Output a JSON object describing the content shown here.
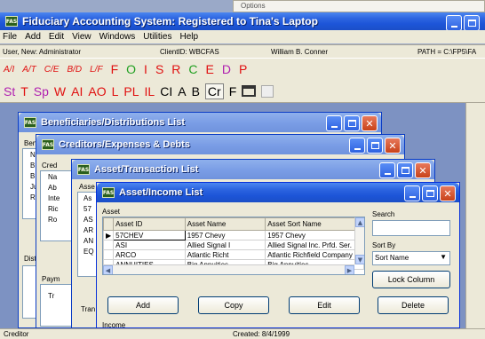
{
  "options_label": "Options",
  "app": {
    "title": "Fiduciary Accounting System: Registered to Tina's Laptop",
    "icon_text": "FAS"
  },
  "menu": [
    "File",
    "Add",
    "Edit",
    "View",
    "Windows",
    "Utilities",
    "Help"
  ],
  "status": {
    "user": "User, New: Administrator",
    "client": "ClientID: WBCFAS",
    "name": "William B. Conner",
    "path": "PATH = C:\\FP5\\FA"
  },
  "toolbar1": {
    "fraction_buttons": [
      "A/I",
      "A/T",
      "C/E",
      "B/D",
      "L/F"
    ],
    "letters": [
      {
        "text": "F",
        "color": "#e01010"
      },
      {
        "text": "O",
        "color": "#22a022"
      },
      {
        "text": "I",
        "color": "#e01010"
      },
      {
        "text": "S",
        "color": "#e01010"
      },
      {
        "text": "R",
        "color": "#e01010"
      },
      {
        "text": "C",
        "color": "#22a022"
      },
      {
        "text": "E",
        "color": "#e01010"
      },
      {
        "text": "D",
        "color": "#b020b0"
      },
      {
        "text": "P",
        "color": "#e01010"
      }
    ]
  },
  "toolbar2": [
    {
      "text": "St",
      "color": "#b020b0"
    },
    {
      "text": "T",
      "color": "#e01010"
    },
    {
      "text": "Sp",
      "color": "#b020b0"
    },
    {
      "text": "W",
      "color": "#e01010"
    },
    {
      "text": "AI",
      "color": "#e01010"
    },
    {
      "text": "AO",
      "color": "#e01010"
    },
    {
      "text": "L",
      "color": "#e01010"
    },
    {
      "text": "PL",
      "color": "#e01010"
    },
    {
      "text": "IL",
      "color": "#e01010"
    },
    {
      "text": "CI",
      "color": "#000000"
    },
    {
      "text": "A",
      "color": "#000000"
    },
    {
      "text": "B",
      "color": "#000000"
    },
    {
      "text": "Cr",
      "color": "#000000"
    },
    {
      "text": "F",
      "color": "#000000"
    }
  ],
  "windows": {
    "beneficiaries": {
      "title": "Beneficiaries/Distributions List",
      "frag_header": "Ben",
      "frag_rows": [
        "N",
        "B",
        "B",
        "Ju",
        "R"
      ],
      "frag_distr": "Distr"
    },
    "creditors": {
      "title": "Creditors/Expenses & Debts",
      "frag_header": "Cred",
      "frag_rows": [
        "Na",
        "Ab",
        "Inte",
        "Ric",
        "Ro"
      ],
      "frag_paym": "Paym",
      "frag_tr": "Tr"
    },
    "assettrans": {
      "title": "Asset/Transaction List",
      "frag_header": "Asse",
      "frag_rows": [
        "As",
        "57",
        "AS",
        "AR",
        "AN",
        "EQ"
      ],
      "frag_tran": "Tran"
    },
    "assetincome": {
      "title": "Asset/Income List",
      "section_label": "Asset",
      "columns": [
        "Asset ID",
        "Asset Name",
        "Asset Sort Name"
      ],
      "rows": [
        [
          "57CHEV",
          "1957 Chevy",
          "1957 Chevy"
        ],
        [
          "ASI",
          "Allied Signal I",
          "Allied Signal Inc. Prfd. Ser."
        ],
        [
          "ARCO",
          "Atlantic Richt",
          "Atlantic Richfield Company"
        ],
        [
          "ANNUITIES",
          "Big Annuities",
          "Big Annuities"
        ]
      ],
      "search_label": "Search",
      "search_value": "",
      "sortby_label": "Sort By",
      "sortby_value": "Sort Name",
      "lock_button": "Lock Column",
      "buttons": [
        "Add",
        "Copy",
        "Edit",
        "Delete"
      ],
      "income_label": "Income"
    }
  },
  "footer": {
    "left": "Creditor",
    "right": "Created: 8/4/1999"
  }
}
